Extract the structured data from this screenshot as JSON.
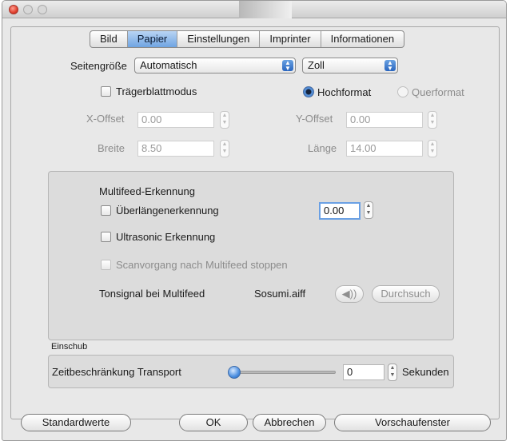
{
  "tabs": [
    "Bild",
    "Papier",
    "Einstellungen",
    "Imprinter",
    "Informationen"
  ],
  "paper": {
    "size_label": "Seitengröße",
    "size_value": "Automatisch",
    "unit_value": "Zoll",
    "carrier_label": "Trägerblattmodus",
    "portrait_label": "Hochformat",
    "landscape_label": "Querformat",
    "x_offset_label": "X-Offset",
    "x_offset_value": "0.00",
    "y_offset_label": "Y-Offset",
    "y_offset_value": "0.00",
    "width_label": "Breite",
    "width_value": "8.50",
    "length_label": "Länge",
    "length_value": "14.00"
  },
  "multifeed": {
    "title": "Multifeed-Erkennung",
    "overlength_label": "Überlängenerkennung",
    "overlength_value": "0.00",
    "ultrasonic_label": "Ultrasonic Erkennung",
    "stop_label": "Scanvorgang nach Multifeed stoppen",
    "sound_label": "Tonsignal bei Multifeed",
    "sound_file": "Sosumi.aiff",
    "play_icon": "speaker-icon",
    "browse_label": "Durchsuch"
  },
  "einschub": {
    "title": "Einschub",
    "transport_label": "Zeitbeschränkung Transport",
    "transport_value": "0",
    "unit_label": "Sekunden"
  },
  "footer": {
    "defaults": "Standardwerte",
    "ok": "OK",
    "cancel": "Abbrechen",
    "preview": "Vorschaufenster"
  }
}
